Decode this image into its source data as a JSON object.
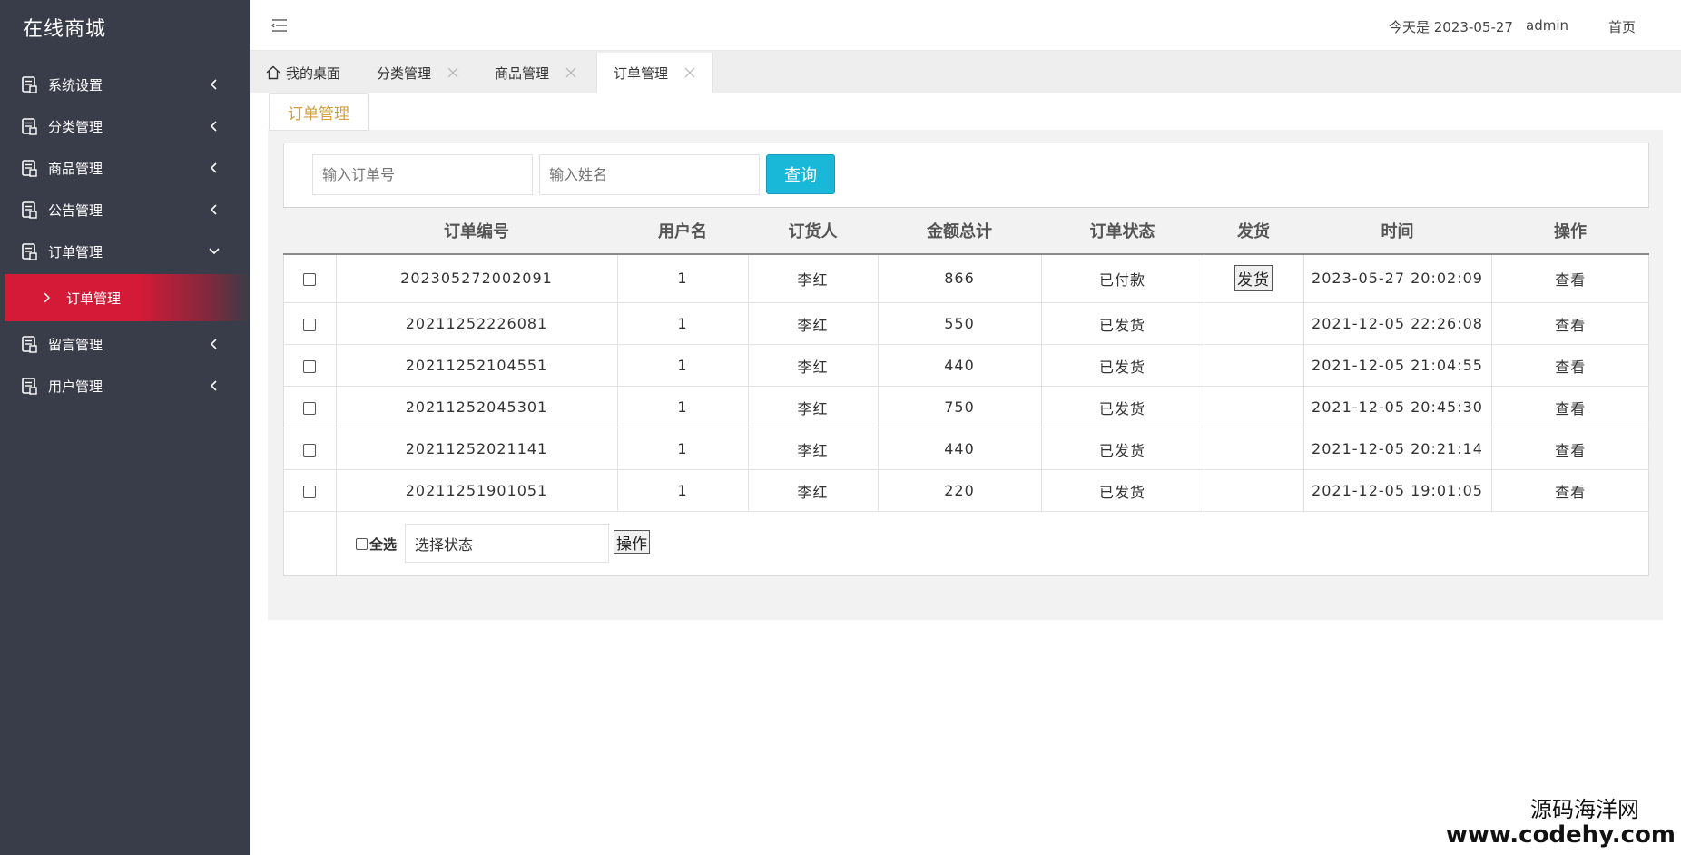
{
  "app": {
    "title": "在线商城"
  },
  "sidebar": {
    "items": [
      {
        "label": "系统设置",
        "expanded": false
      },
      {
        "label": "分类管理",
        "expanded": false
      },
      {
        "label": "商品管理",
        "expanded": false
      },
      {
        "label": "公告管理",
        "expanded": false
      },
      {
        "label": "订单管理",
        "expanded": true
      },
      {
        "label": "留言管理",
        "expanded": false
      },
      {
        "label": "用户管理",
        "expanded": false
      }
    ],
    "active_sub": {
      "label": "订单管理"
    },
    "active_color": "#d41a36"
  },
  "header": {
    "date_text": "今天是 2023-05-27",
    "user": "admin",
    "home": "首页"
  },
  "tabs": [
    {
      "label": "我的桌面"
    },
    {
      "label": "分类管理"
    },
    {
      "label": "商品管理"
    },
    {
      "label": "订单管理"
    }
  ],
  "section": {
    "title": "订单管理"
  },
  "search": {
    "order_placeholder": "输入订单号",
    "name_placeholder": "输入姓名",
    "button": "查询"
  },
  "table": {
    "headers": [
      "订单编号",
      "用户名",
      "订货人",
      "金额总计",
      "订单状态",
      "发货",
      "时间",
      "操作"
    ],
    "rows": [
      {
        "order_no": "202305272002091",
        "user": "1",
        "customer": "李红",
        "amount": "866",
        "status": "已付款",
        "ship": "发货",
        "time": "2023-05-27 20:02:09",
        "action": "查看"
      },
      {
        "order_no": "20211252226081",
        "user": "1",
        "customer": "李红",
        "amount": "550",
        "status": "已发货",
        "ship": "",
        "time": "2021-12-05 22:26:08",
        "action": "查看"
      },
      {
        "order_no": "20211252104551",
        "user": "1",
        "customer": "李红",
        "amount": "440",
        "status": "已发货",
        "ship": "",
        "time": "2021-12-05 21:04:55",
        "action": "查看"
      },
      {
        "order_no": "20211252045301",
        "user": "1",
        "customer": "李红",
        "amount": "750",
        "status": "已发货",
        "ship": "",
        "time": "2021-12-05 20:45:30",
        "action": "查看"
      },
      {
        "order_no": "20211252021141",
        "user": "1",
        "customer": "李红",
        "amount": "440",
        "status": "已发货",
        "ship": "",
        "time": "2021-12-05 20:21:14",
        "action": "查看"
      },
      {
        "order_no": "20211251901051",
        "user": "1",
        "customer": "李红",
        "amount": "220",
        "status": "已发货",
        "ship": "",
        "time": "2021-12-05 19:01:05",
        "action": "查看"
      }
    ]
  },
  "footer": {
    "select_all": "全选",
    "status_select": "选择状态",
    "op_button": "操作"
  },
  "watermark": {
    "line1": "源码海洋网",
    "line2": "www.codehy.com"
  }
}
